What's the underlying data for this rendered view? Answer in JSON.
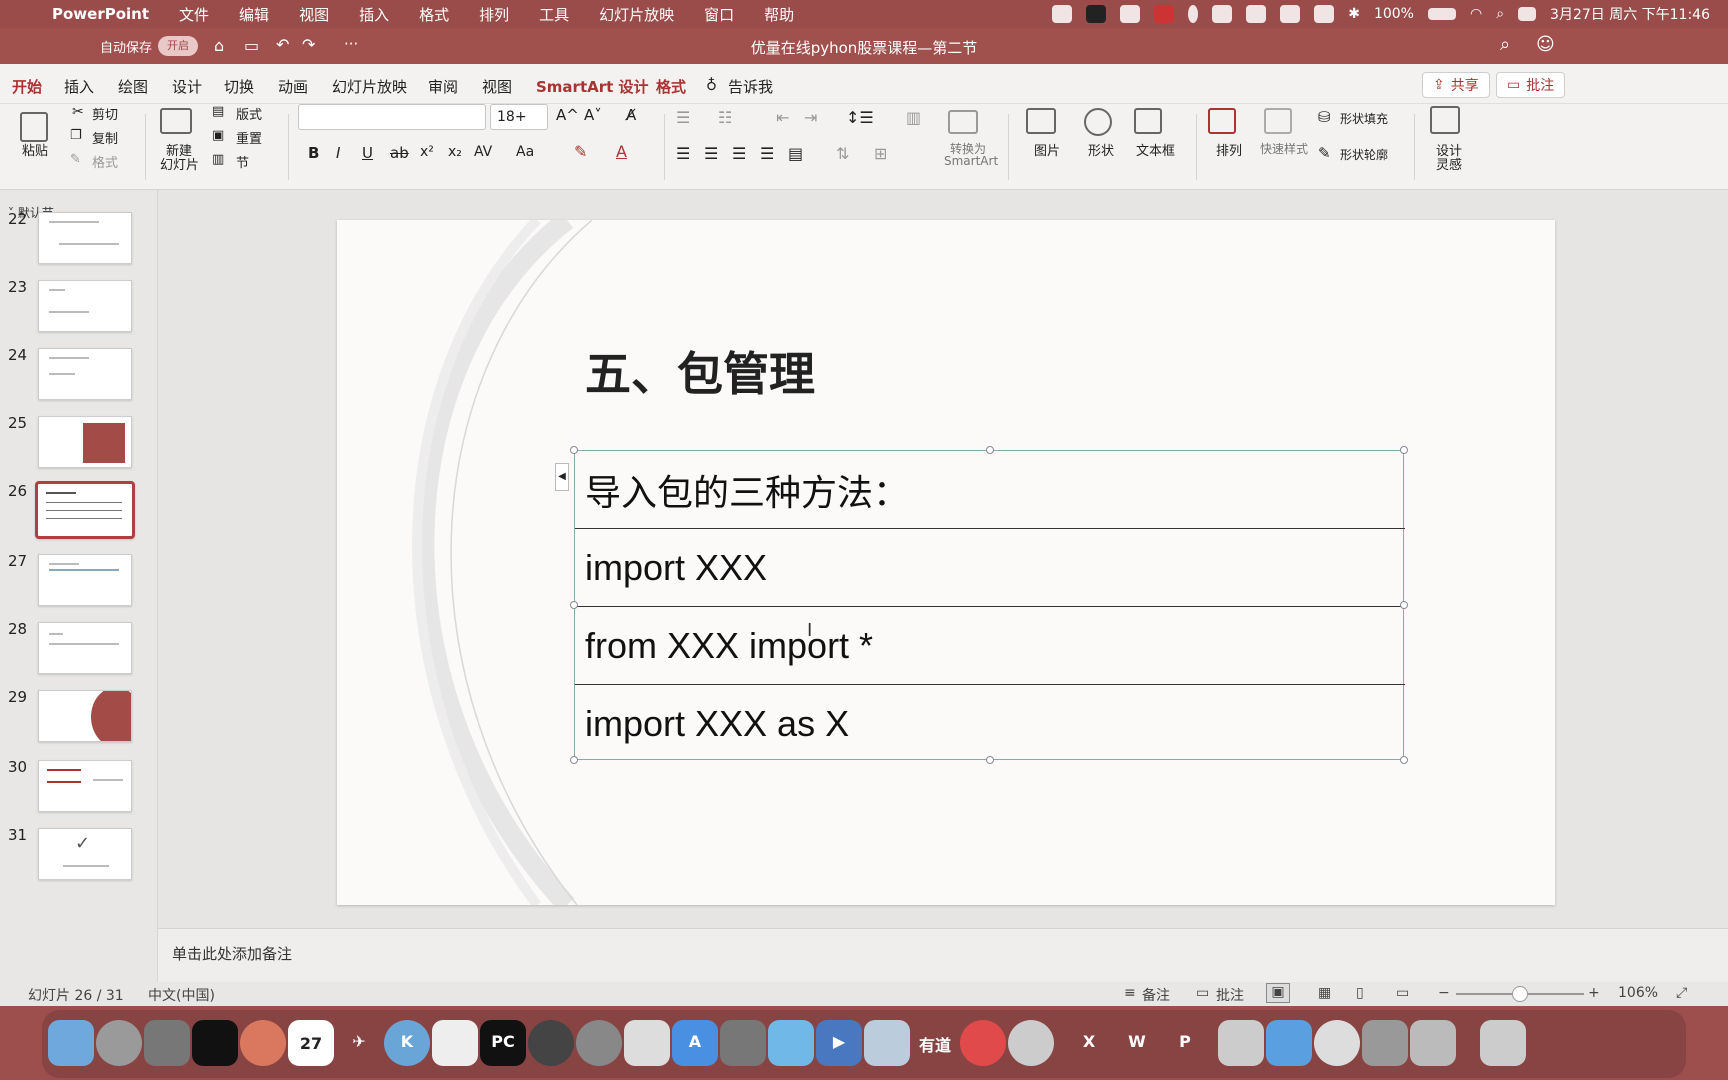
{
  "menubar": {
    "app": "PowerPoint",
    "items": [
      "文件",
      "编辑",
      "视图",
      "插入",
      "格式",
      "排列",
      "工具",
      "幻灯片放映",
      "窗口",
      "帮助"
    ],
    "battery": "100%",
    "datetime": "3月27日 周六 下午11:46"
  },
  "titlebar": {
    "autosave_label": "自动保存",
    "autosave_state": "开启",
    "more": "···",
    "doc_title": "优量在线pyhon股票课程—第二节"
  },
  "tabs": {
    "items": [
      "开始",
      "插入",
      "绘图",
      "设计",
      "切换",
      "动画",
      "幻灯片放映",
      "审阅",
      "视图",
      "SmartArt 设计",
      "格式"
    ],
    "tell_me": "告诉我",
    "share": "共享",
    "comments": "批注"
  },
  "ribbon": {
    "paste": "粘贴",
    "cut": "剪切",
    "copy": "复制",
    "format": "格式",
    "new_slide_1": "新建",
    "new_slide_2": "幻灯片",
    "layout": "版式",
    "reset": "重置",
    "section": "节",
    "font_name": "",
    "font_size": "18+",
    "grow": "A^",
    "shrink": "A˅",
    "bold": "B",
    "italic": "I",
    "underline": "U",
    "strike": "ab",
    "superscript": "x²",
    "subscript": "x₂",
    "spacing": "AV",
    "case": "Aa",
    "convert_1": "转换为",
    "convert_2": "SmartArt",
    "picture": "图片",
    "shape": "形状",
    "textbox": "文本框",
    "arrange": "排列",
    "quick_styles": "快速样式",
    "shape_fill": "形状填充",
    "shape_outline": "形状轮廓",
    "designer_1": "设计",
    "designer_2": "灵感"
  },
  "panel": {
    "section_name": "默认节",
    "slide_numbers": [
      "22",
      "23",
      "24",
      "25",
      "26",
      "27",
      "28",
      "29",
      "30",
      "31"
    ],
    "selected": "26"
  },
  "slide": {
    "title": "五、包管理",
    "rows": [
      "导入包的三种方法：",
      "import XXX",
      "from XXX import *",
      "import XXX as X"
    ]
  },
  "notes": {
    "placeholder": "单击此处添加备注"
  },
  "status": {
    "slide_counter": "幻灯片 26 / 31",
    "language": "中文(中国)",
    "notes_btn": "备注",
    "comments_btn": "批注",
    "zoom": "106%"
  },
  "dock": {
    "calendar_day": "27",
    "apps": [
      "Finder",
      "Launchpad",
      "Mission Control",
      "Terminal",
      "Photos",
      "Calendar",
      "Xcode",
      "Keynote",
      "Reminders",
      "PyCharm",
      "OBS",
      "Settings",
      "Folder",
      "App Store",
      "Screen Tool",
      "Feishu",
      "Video",
      "Network",
      "有道",
      "Mosaic",
      "WeChat",
      "Excel",
      "Word",
      "PowerPoint",
      "Desktop",
      "S",
      "QuickTime",
      "Preview",
      "Windows",
      "Trash"
    ],
    "youdao_label": "有道",
    "pycharm_label": "PC",
    "excel_label": "X",
    "word_label": "W",
    "ppt_label": "P"
  },
  "colors": {
    "accent": "#a33333",
    "titlebar": "#a0504d",
    "menubar": "#9a4c4a"
  }
}
